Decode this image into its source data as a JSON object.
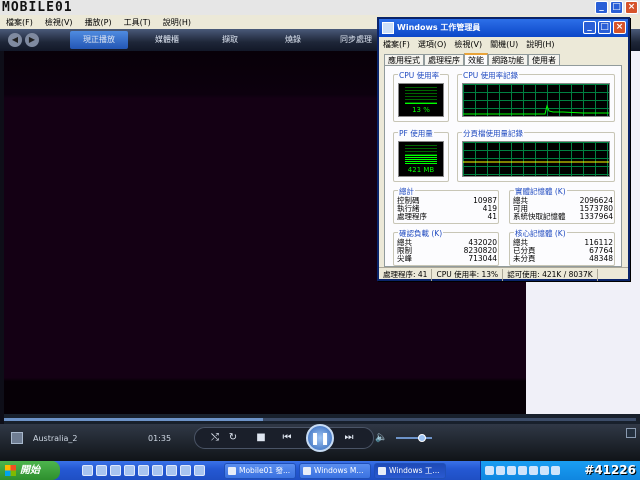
{
  "wmp": {
    "logo": "MOBILE01",
    "menu": [
      "檔案(F)",
      "檢視(V)",
      "播放(P)",
      "工具(T)",
      "說明(H)"
    ],
    "tabs": [
      "現正播放",
      "媒體櫃",
      "擷取",
      "燒錄",
      "同步處理"
    ],
    "active_tab": 0,
    "track_name": "Australia_2",
    "track_time": "01:35",
    "seek_progress": 0.41,
    "volume_level": 0.72,
    "controls": {
      "shuffle": "⤭",
      "repeat": "↻",
      "stop": "■",
      "prev": "⏮",
      "play_pause": "❚❚",
      "next": "⏭",
      "volume": "🔈"
    }
  },
  "taskmgr": {
    "title": "Windows 工作管理員",
    "menu": [
      "檔案(F)",
      "選項(O)",
      "檢視(V)",
      "關機(U)",
      "說明(H)"
    ],
    "tabs": [
      "應用程式",
      "處理程序",
      "效能",
      "網路功能",
      "使用者"
    ],
    "active_tab": 2,
    "cpu_usage_label": "CPU 使用率",
    "cpu_usage_value": "13 %",
    "cpu_usage_fraction": 0.13,
    "cpu_history_label": "CPU 使用率記錄",
    "pf_usage_label": "PF 使用量",
    "pf_usage_value": "421 MB",
    "pf_usage_fraction": 0.5,
    "pf_history_label": "分頁檔使用量記錄",
    "totals": {
      "title": "總計",
      "rows": [
        {
          "label": "控制碼",
          "value": "10987"
        },
        {
          "label": "執行緒",
          "value": "419"
        },
        {
          "label": "處理程序",
          "value": "41"
        }
      ]
    },
    "physical": {
      "title": "實體記憶體 (K)",
      "rows": [
        {
          "label": "總共",
          "value": "2096624"
        },
        {
          "label": "可用",
          "value": "1573780"
        },
        {
          "label": "系統快取記憶體",
          "value": "1337964"
        }
      ]
    },
    "commit": {
      "title": "確認負載 (K)",
      "rows": [
        {
          "label": "總共",
          "value": "432020"
        },
        {
          "label": "限制",
          "value": "8230820"
        },
        {
          "label": "尖峰",
          "value": "713044"
        }
      ]
    },
    "kernel": {
      "title": "核心記憶體 (K)",
      "rows": [
        {
          "label": "總共",
          "value": "116112"
        },
        {
          "label": "已分頁",
          "value": "67764"
        },
        {
          "label": "未分頁",
          "value": "48348"
        }
      ]
    },
    "status": {
      "processes": "處理程序: 41",
      "cpu": "CPU 使用率: 13%",
      "commit": "認可使用: 421K / 8037K"
    }
  },
  "taskbar": {
    "start_label": "開始",
    "buttons": [
      {
        "label": "Mobile01 發...",
        "active": false
      },
      {
        "label": "Windows M...",
        "active": false
      },
      {
        "label": "Windows 工...",
        "active": true
      }
    ]
  },
  "watermark": "#41226",
  "colors": {
    "xp_blue": "#2a5fd6",
    "meter_green": "#00ff00",
    "group_label_blue": "#1f4ac0",
    "start_green": "#3a9e3a"
  }
}
